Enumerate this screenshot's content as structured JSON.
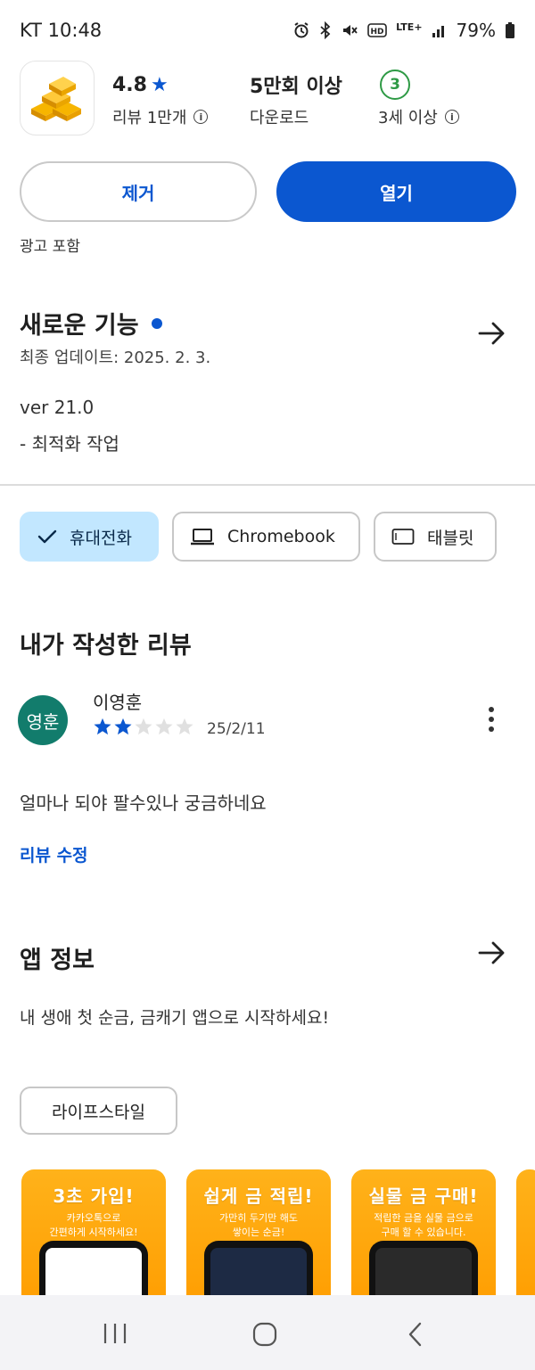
{
  "status_bar": {
    "carrier_time": "KT 10:48",
    "network": "LTE+",
    "battery": "79%",
    "icons": [
      "alarm-icon",
      "bluetooth-icon",
      "mute-icon",
      "hd-icon",
      "lte-icon",
      "signal-icon",
      "battery-icon"
    ]
  },
  "app": {
    "icon": "gold-bars-icon",
    "rating": "4.8",
    "rating_star": "★",
    "reviews": "리뷰 1만개",
    "downloads": "5만회 이상",
    "downloads_label": "다운로드",
    "age_rating": "3",
    "age_label": "3세 이상",
    "info_glyph": "i"
  },
  "actions": {
    "uninstall": "제거",
    "open": "열기",
    "ads_notice": "광고 포함"
  },
  "whats_new": {
    "title": "새로운 기능",
    "updated": "최종 업데이트: 2025. 2. 3.",
    "version": "ver 21.0",
    "notes": "- 최적화 작업"
  },
  "devices": {
    "phone": "휴대전화",
    "chromebook": "Chromebook",
    "tablet": "태블릿"
  },
  "my_review": {
    "title": "내가 작성한 리뷰",
    "avatar_text": "영훈",
    "reviewer": "이영훈",
    "stars": 2,
    "max_stars": 5,
    "date": "25/2/11",
    "text": "얼마나 되야 팔수있나 궁금하네요",
    "edit": "리뷰 수정"
  },
  "app_info": {
    "title": "앱 정보",
    "description": "내 생애 첫 순금, 금캐기 앱으로 시작하세요!",
    "category": "라이프스타일"
  },
  "screenshots": [
    {
      "headline": "3초 가입!",
      "line1": "카카오톡으로",
      "line2": "간편하게 시작하세요!"
    },
    {
      "headline": "쉽게 금 적립!",
      "line1": "가만히 두기만 해도",
      "line2": "쌓이는 순금!"
    },
    {
      "headline": "실물 금 구매!",
      "line1": "적립한 금을 실물 금으로",
      "line2": "구매 할 수 있습니다."
    }
  ],
  "colors": {
    "primary": "#0b57d0",
    "chip_selected": "#c2e7ff",
    "age_green": "#2e9a45",
    "avatar": "#127c6c",
    "screenshot_bg": "#ffa80d"
  }
}
